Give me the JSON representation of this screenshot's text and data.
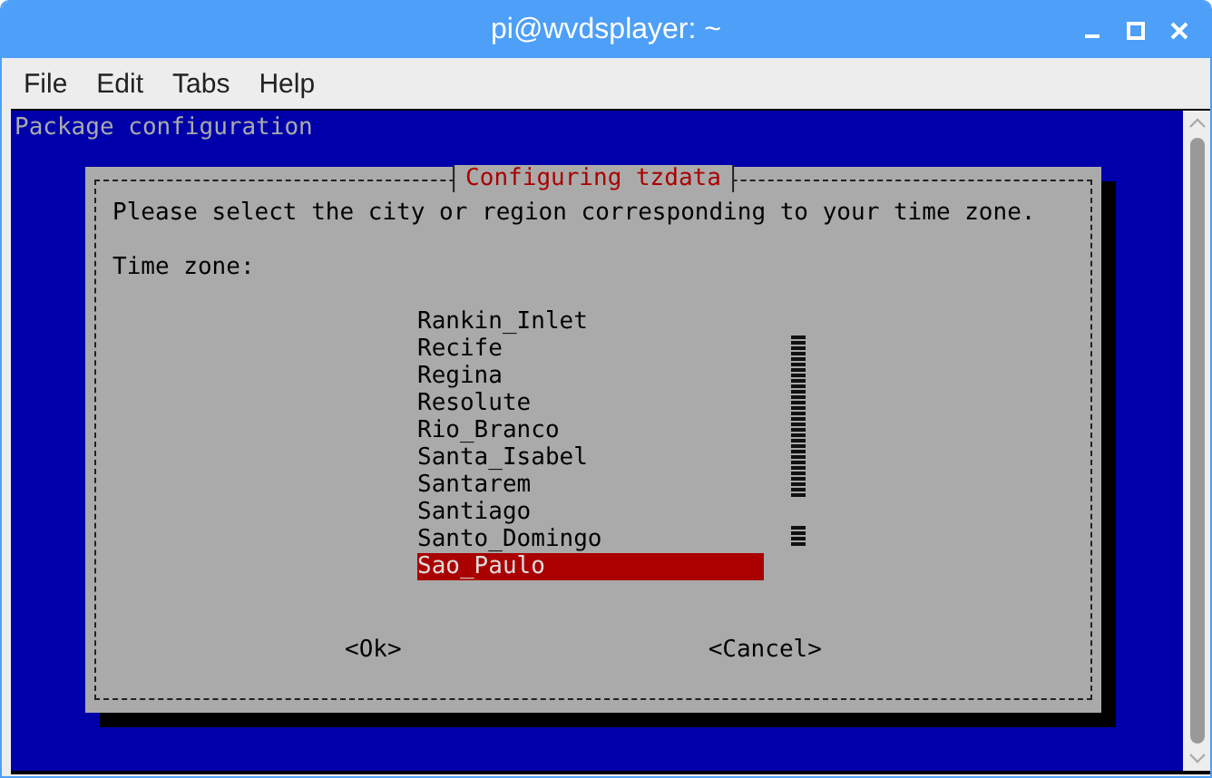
{
  "window": {
    "title": "pi@wvdsplayer: ~"
  },
  "menu": [
    "File",
    "Edit",
    "Tabs",
    "Help"
  ],
  "terminal": {
    "header": "Package configuration",
    "dialog": {
      "title": "Configuring tzdata",
      "prompt": "Please select the city or region corresponding to your time zone.",
      "label": "Time zone:",
      "items": [
        {
          "text": "Rankin_Inlet",
          "selected": false
        },
        {
          "text": "Recife",
          "selected": false
        },
        {
          "text": "Regina",
          "selected": false
        },
        {
          "text": "Resolute",
          "selected": false
        },
        {
          "text": "Rio_Branco",
          "selected": false
        },
        {
          "text": "Santa_Isabel",
          "selected": false
        },
        {
          "text": "Santarem",
          "selected": false
        },
        {
          "text": "Santiago",
          "selected": false
        },
        {
          "text": "Santo_Domingo",
          "selected": false
        },
        {
          "text": "Sao_Paulo",
          "selected": true
        }
      ],
      "buttons": [
        "<Ok>",
        "<Cancel>"
      ]
    }
  }
}
